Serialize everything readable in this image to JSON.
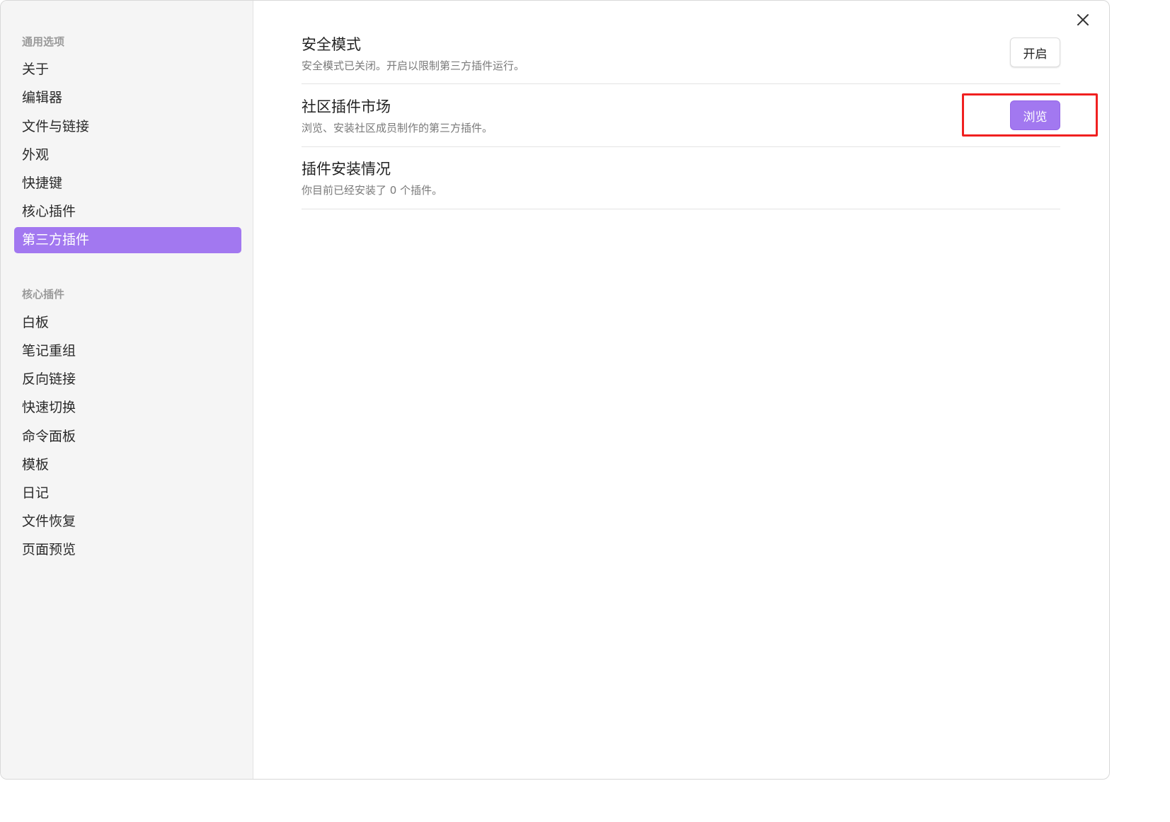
{
  "sidebar": {
    "general_title": "通用选项",
    "general_items": [
      {
        "label": "关于"
      },
      {
        "label": "编辑器"
      },
      {
        "label": "文件与链接"
      },
      {
        "label": "外观"
      },
      {
        "label": "快捷键"
      },
      {
        "label": "核心插件"
      },
      {
        "label": "第三方插件"
      }
    ],
    "core_title": "核心插件",
    "core_items": [
      {
        "label": "白板"
      },
      {
        "label": "笔记重组"
      },
      {
        "label": "反向链接"
      },
      {
        "label": "快速切换"
      },
      {
        "label": "命令面板"
      },
      {
        "label": "模板"
      },
      {
        "label": "日记"
      },
      {
        "label": "文件恢复"
      },
      {
        "label": "页面预览"
      }
    ],
    "active_item": "第三方插件"
  },
  "main": {
    "settings": [
      {
        "name": "安全模式",
        "description": "安全模式已关闭。开启以限制第三方插件运行。",
        "button": "开启"
      },
      {
        "name": "社区插件市场",
        "description": "浏览、安装社区成员制作的第三方插件。",
        "button": "浏览"
      },
      {
        "name": "插件安装情况",
        "description": "你目前已经安装了 0 个插件。"
      }
    ]
  },
  "icons": {
    "close": "close-icon"
  },
  "colors": {
    "accent": "#a278f0",
    "highlight_box": "#f02020",
    "sidebar_bg": "#f5f5f5"
  }
}
